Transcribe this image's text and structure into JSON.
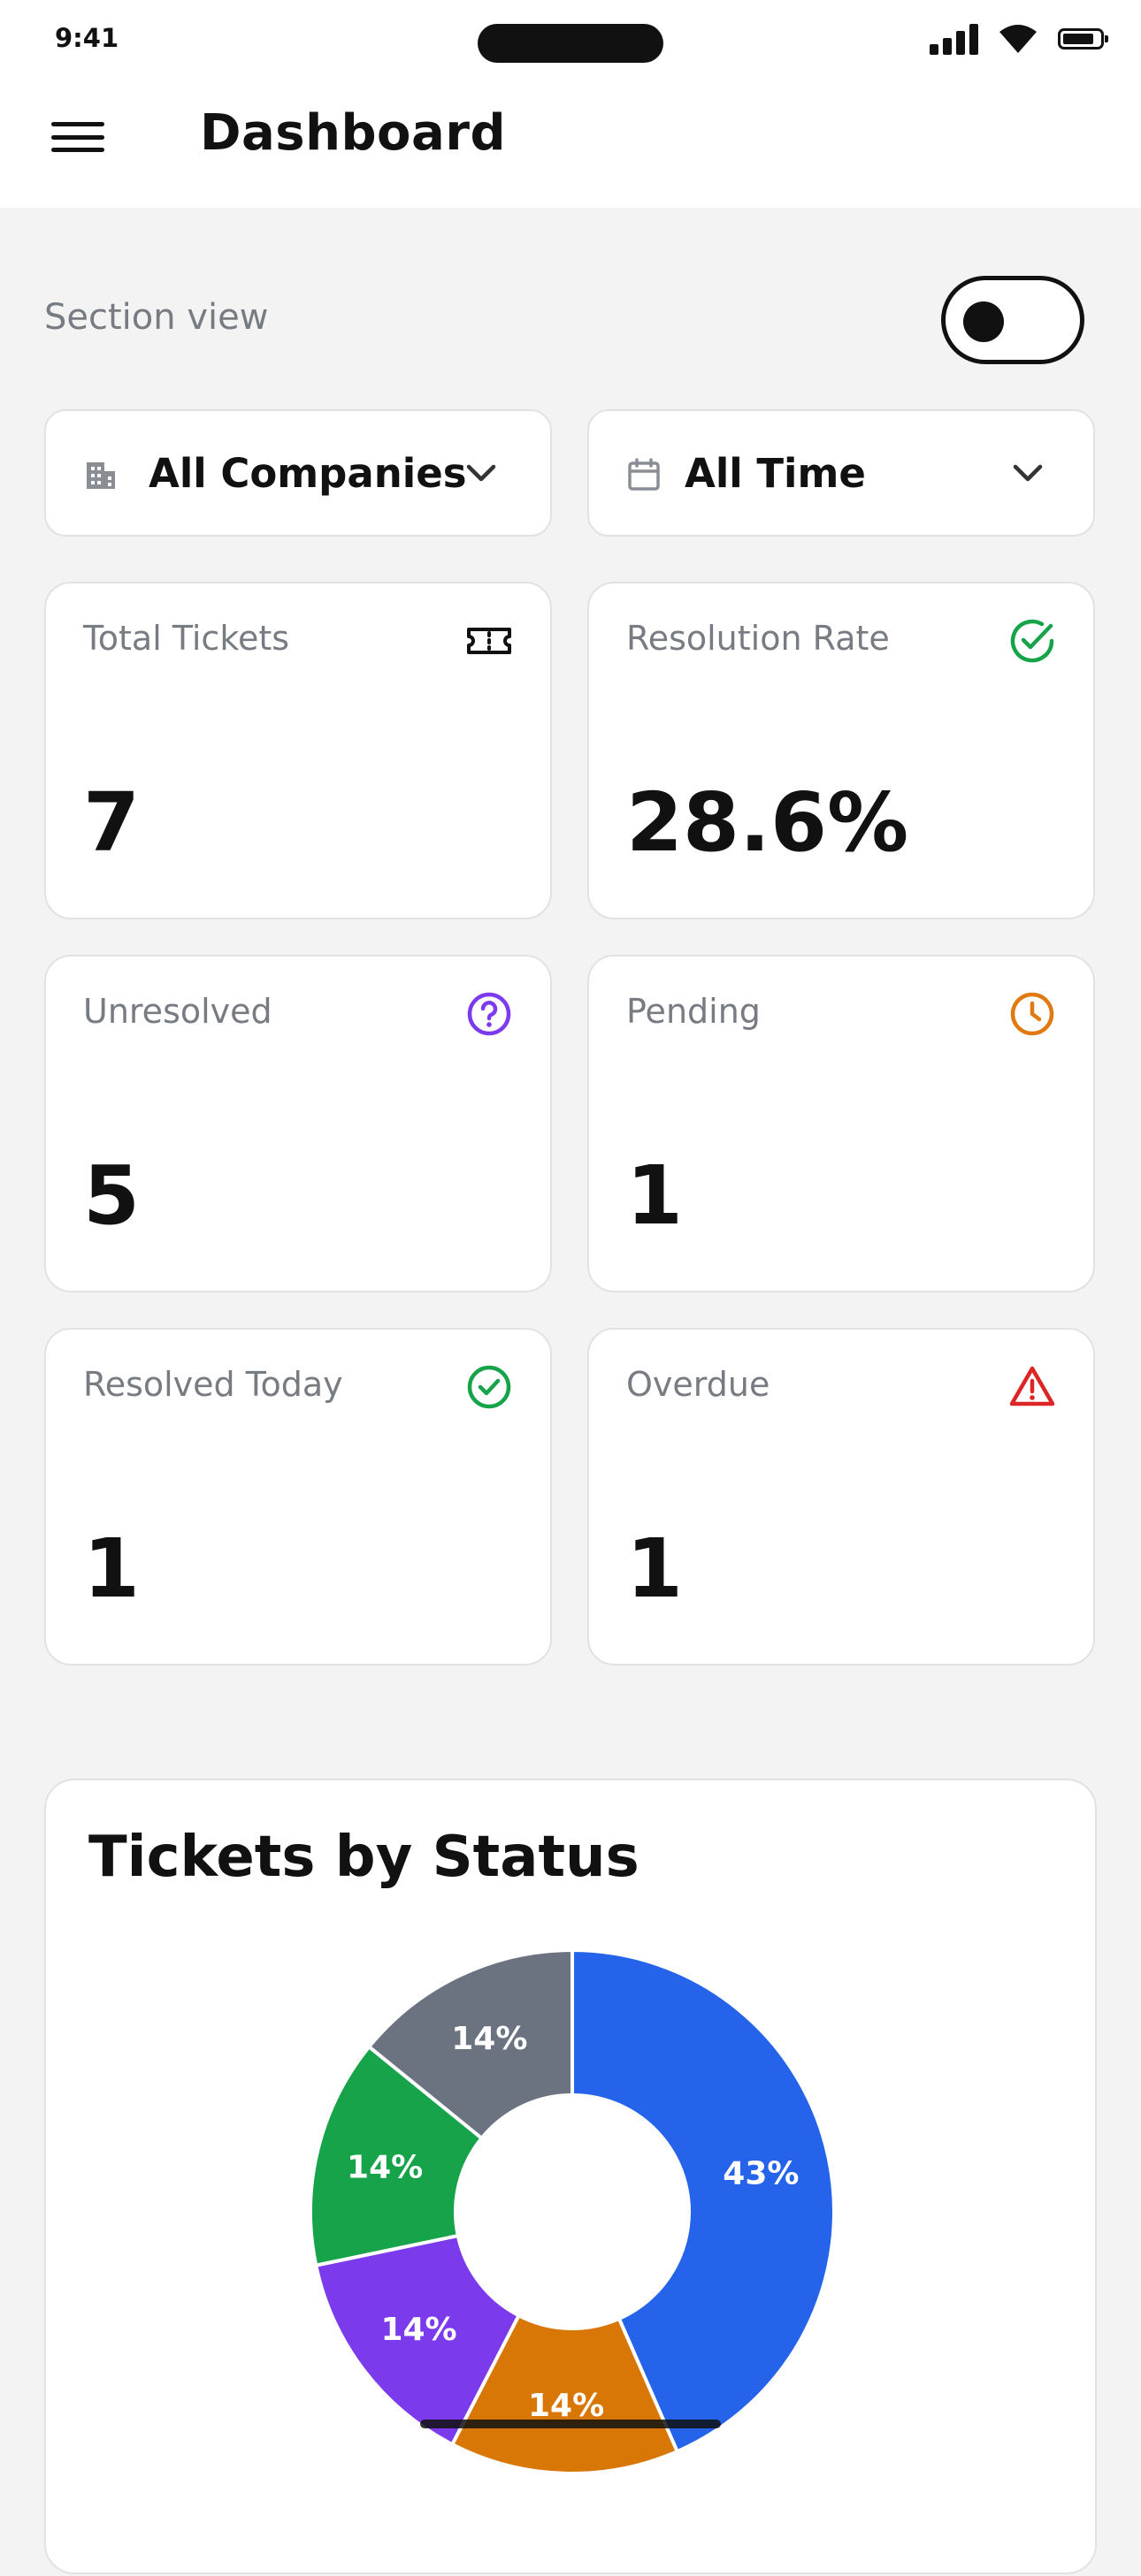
{
  "status_bar": {
    "time": "9:41"
  },
  "header": {
    "title": "Dashboard"
  },
  "section": {
    "label": "Section view",
    "toggle_on": false
  },
  "filters": {
    "company": {
      "label": "All Companies",
      "icon": "building-icon"
    },
    "period": {
      "label": "All Time",
      "icon": "calendar-icon"
    }
  },
  "stats": [
    {
      "label": "Total Tickets",
      "value": "7",
      "icon": "ticket-icon",
      "color": "#111111"
    },
    {
      "label": "Resolution Rate",
      "value": "28.6%",
      "icon": "check-circle-icon",
      "color": "#16a34a"
    },
    {
      "label": "Unresolved",
      "value": "5",
      "icon": "question-circle-icon",
      "color": "#7c3aed"
    },
    {
      "label": "Pending",
      "value": "1",
      "icon": "clock-icon",
      "color": "#e07a10"
    },
    {
      "label": "Resolved Today",
      "value": "1",
      "icon": "check-circle-icon",
      "color": "#16a34a"
    },
    {
      "label": "Overdue",
      "value": "1",
      "icon": "warning-triangle-icon",
      "color": "#dc2626"
    }
  ],
  "chart_data": {
    "type": "pie",
    "title": "Tickets by Status",
    "slices": [
      {
        "label": "43%",
        "value": 43,
        "color": "#2563eb"
      },
      {
        "label": "14%",
        "value": 14,
        "color": "#d97706"
      },
      {
        "label": "14%",
        "value": 14,
        "color": "#7c3aed"
      },
      {
        "label": "14%",
        "value": 14,
        "color": "#16a34a"
      },
      {
        "label": "14%",
        "value": 14,
        "color": "#6b7280"
      }
    ]
  }
}
